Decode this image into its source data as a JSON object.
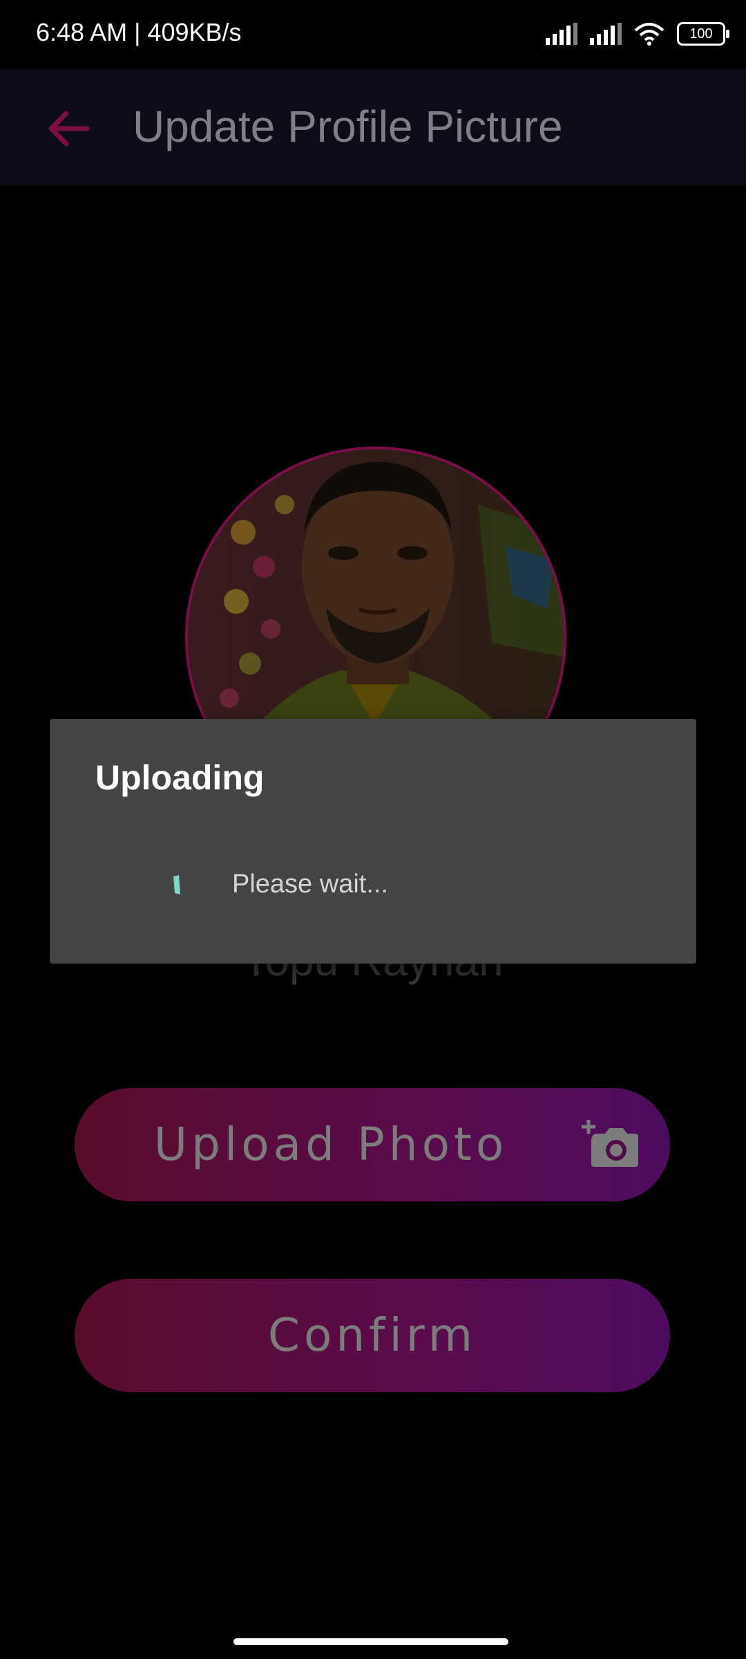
{
  "status_bar": {
    "time": "6:48 AM | 409KB/s",
    "battery": "100"
  },
  "app_bar": {
    "title": "Update Profile Picture",
    "back_icon": "arrow-left-icon"
  },
  "profile": {
    "name": "Topu Rayhan"
  },
  "buttons": {
    "upload_label": "Upload Photo",
    "upload_icon": "add-camera-icon",
    "confirm_label": "Confirm"
  },
  "dialog": {
    "title": "Uploading",
    "message": "Please wait..."
  },
  "colors": {
    "accent": "#8a0e4a",
    "button_gradient_start": "#5a0c2c",
    "button_gradient_end": "#4e0c60",
    "dialog_bg": "#444444",
    "spinner": "#7fd6c8"
  }
}
